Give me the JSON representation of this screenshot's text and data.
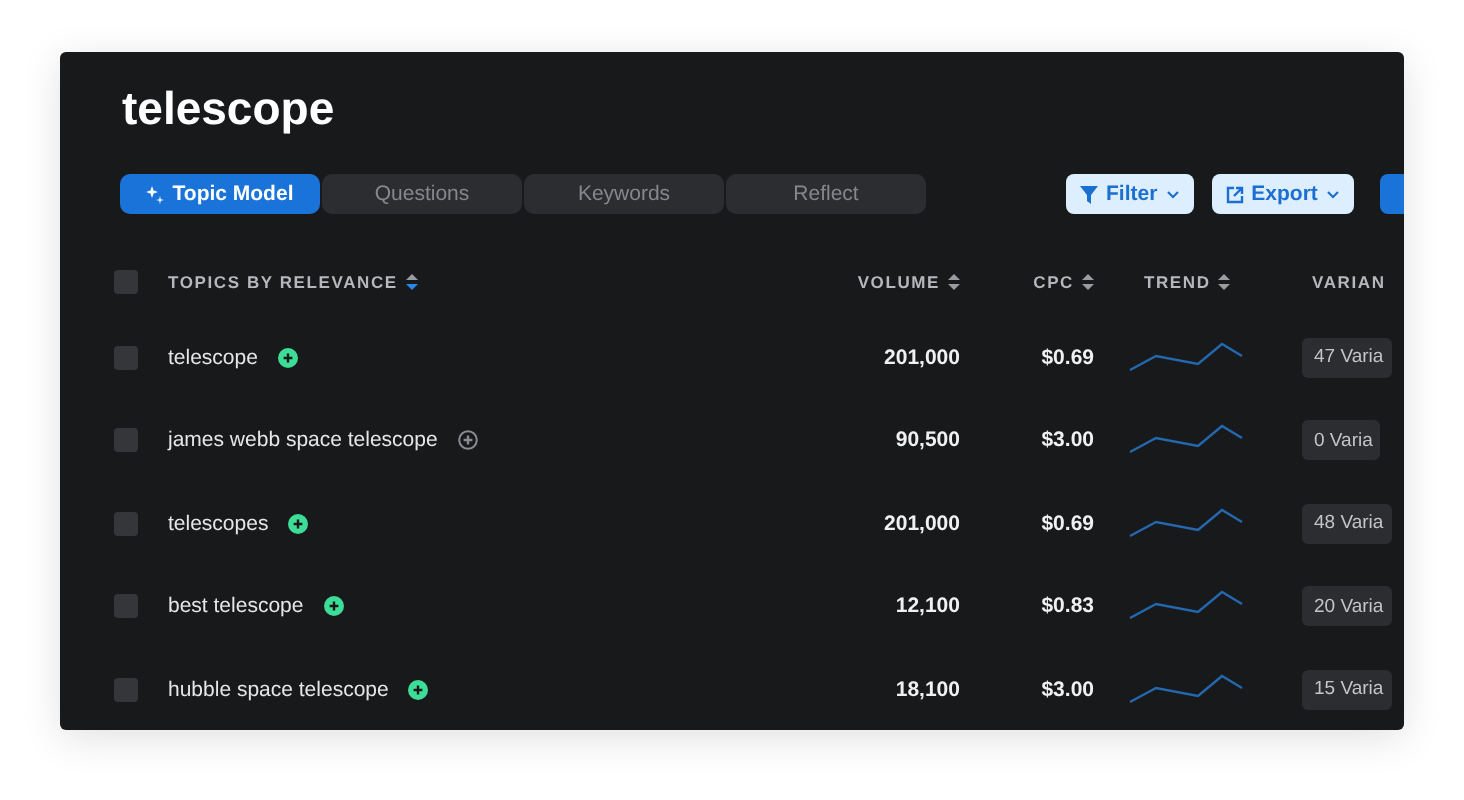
{
  "title": "telescope",
  "tabs": [
    {
      "label": "Topic Model",
      "selected": true
    },
    {
      "label": "Questions",
      "selected": false
    },
    {
      "label": "Keywords",
      "selected": false
    },
    {
      "label": "Reflect",
      "selected": false
    }
  ],
  "actions": [
    "Filter",
    "Export"
  ],
  "select_all_checked": false,
  "columns": [
    "TOPICS BY RELEVANCE",
    "VOLUME",
    "CPC",
    "TREND",
    "VARIAN"
  ],
  "rows": [
    {
      "topic": "telescope",
      "active": true,
      "volume": "201,000",
      "cpc": "$0.69",
      "variants": "47 Varia",
      "checked": false
    },
    {
      "topic": "james webb space telescope",
      "active": false,
      "volume": "90,500",
      "cpc": "$3.00",
      "variants": "0 Varia",
      "checked": false
    },
    {
      "topic": "telescopes",
      "active": true,
      "volume": "201,000",
      "cpc": "$0.69",
      "variants": "48 Varia",
      "checked": false
    },
    {
      "topic": "best telescope",
      "active": true,
      "volume": "12,100",
      "cpc": "$0.83",
      "variants": "20 Varia",
      "checked": false
    },
    {
      "topic": "hubble space telescope",
      "active": true,
      "volume": "18,100",
      "cpc": "$3.00",
      "variants": "15 Varia",
      "checked": false
    }
  ]
}
